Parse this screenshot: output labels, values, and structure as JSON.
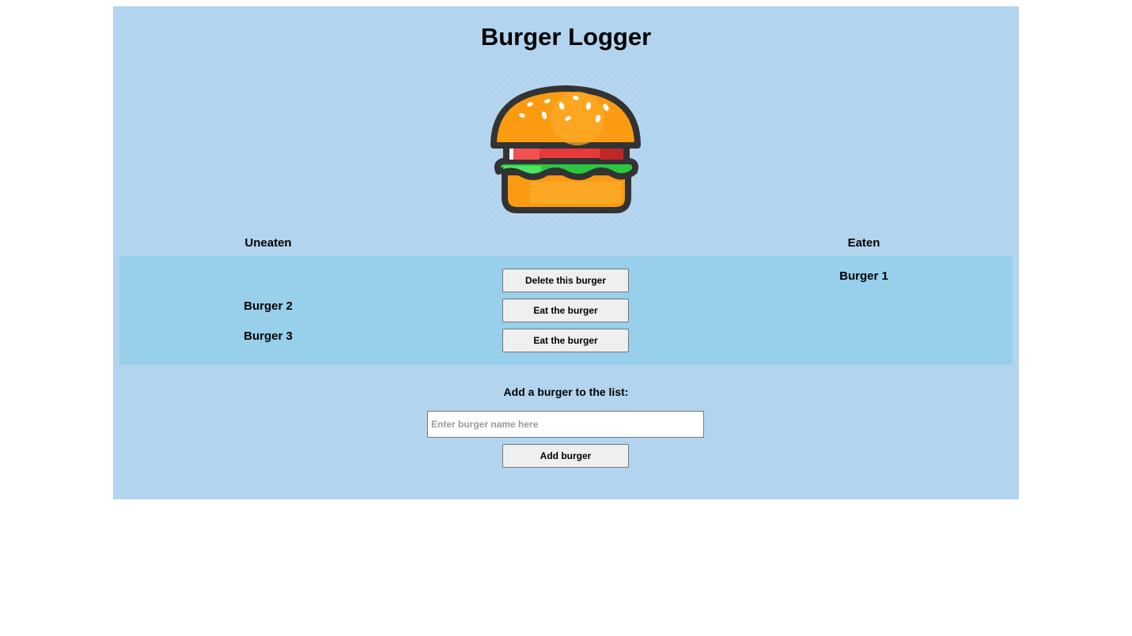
{
  "header": {
    "title": "Burger Logger"
  },
  "logo": {
    "icon": "burger-icon"
  },
  "columns": {
    "uneaten": "Uneaten",
    "eaten": "Eaten"
  },
  "uneaten": [
    {
      "name": "Burger 2",
      "action": "Eat the burger"
    },
    {
      "name": "Burger 3",
      "action": "Eat the burger"
    }
  ],
  "eaten": [
    {
      "name": "Burger 1",
      "action": "Delete this burger"
    }
  ],
  "form": {
    "label": "Add a burger to the list:",
    "placeholder": "Enter burger name here",
    "value": "",
    "submit_label": "Add burger"
  },
  "colors": {
    "page_bg": "#ffffff",
    "container_bg": "#b3d4ef",
    "list_bg": "#98cfea",
    "button_bg": "#efefef"
  }
}
